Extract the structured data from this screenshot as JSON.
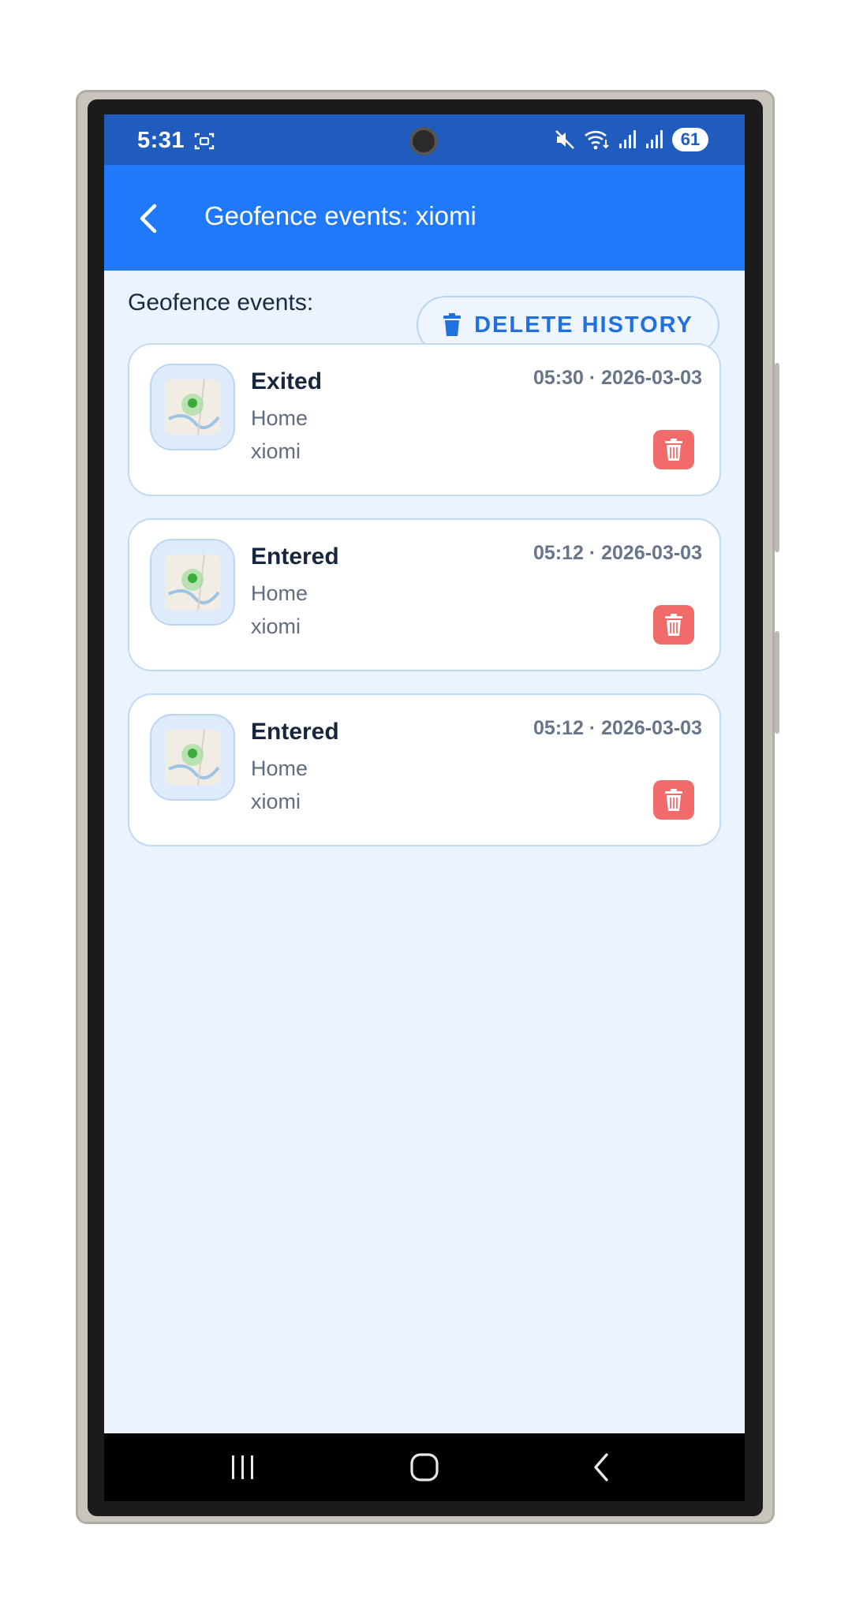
{
  "status_bar": {
    "time": "5:31",
    "battery": "61",
    "icons": [
      "screenshot-icon",
      "mute-icon",
      "wifi-icon",
      "signal-icon",
      "signal-icon",
      "battery-icon"
    ]
  },
  "app_bar": {
    "title": "Geofence events: xiomi",
    "back_icon": "chevron-left-icon"
  },
  "content": {
    "section_label": "Geofence events:",
    "delete_history_label": "DELETE HISTORY"
  },
  "events": [
    {
      "type": "Exited",
      "place": "Home",
      "device": "xiomi",
      "time": "05:30 · 2026-03-03"
    },
    {
      "type": "Entered",
      "place": "Home",
      "device": "xiomi",
      "time": "05:12 · 2026-03-03"
    },
    {
      "type": "Entered",
      "place": "Home",
      "device": "xiomi",
      "time": "05:12 · 2026-03-03"
    }
  ],
  "nav_bar": {
    "icons": [
      "recents-icon",
      "home-icon",
      "back-icon"
    ]
  },
  "colors": {
    "status_bar": "#1f5cbd",
    "app_bar": "#2079f8",
    "background": "#eaf3fe",
    "accent": "#2070e0",
    "danger": "#f26b6b"
  }
}
